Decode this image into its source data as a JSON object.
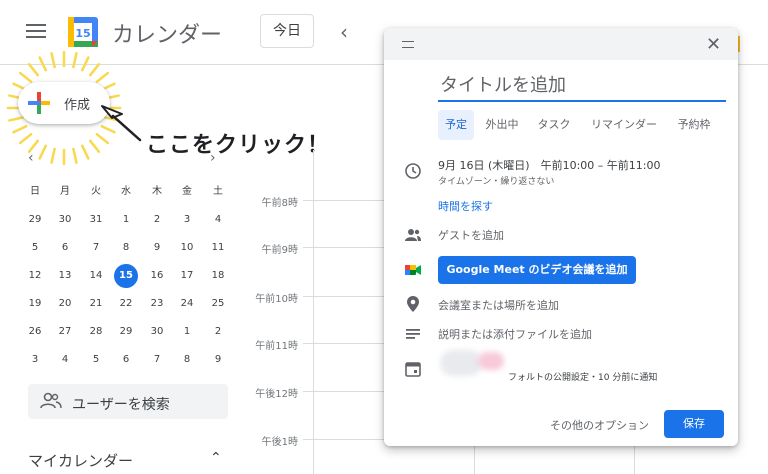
{
  "header": {
    "app_title": "カレンダー",
    "logo_day": "15",
    "today_button": "今日",
    "prev_icon": "chevron-left-icon"
  },
  "create": {
    "label": "作成",
    "callout": "ここをクリック！"
  },
  "mini_calendar": {
    "weekdays": [
      "日",
      "月",
      "火",
      "水",
      "木",
      "金",
      "土"
    ],
    "weeks": [
      [
        "29",
        "30",
        "31",
        "1",
        "2",
        "3",
        "4"
      ],
      [
        "5",
        "6",
        "7",
        "8",
        "9",
        "10",
        "11"
      ],
      [
        "12",
        "13",
        "14",
        "15",
        "16",
        "17",
        "18"
      ],
      [
        "19",
        "20",
        "21",
        "22",
        "23",
        "24",
        "25"
      ],
      [
        "26",
        "27",
        "28",
        "29",
        "30",
        "1",
        "2"
      ],
      [
        "3",
        "4",
        "5",
        "6",
        "7",
        "8",
        "9"
      ]
    ],
    "today": "15"
  },
  "people_search": {
    "label": "ユーザーを検索"
  },
  "my_calendars": {
    "label": "マイカレンダー"
  },
  "time_labels": [
    "午前8時",
    "午前9時",
    "午前10時",
    "午前11時",
    "午後12時",
    "午後1時"
  ],
  "dialog": {
    "title_placeholder": "タイトルを追加",
    "tabs": [
      "予定",
      "外出中",
      "タスク",
      "リマインダー",
      "予約枠"
    ],
    "active_tab": "予定",
    "date_time": "9月 16日 (木曜日)　午前10:00 – 午前11:00",
    "date_sub": "タイムゾーン・繰り返さない",
    "find_time": "時間を探す",
    "add_guests": "ゲストを追加",
    "meet_button": "Google Meet のビデオ会議を追加",
    "add_location": "会議室または場所を追加",
    "add_description": "説明または添付ファイルを追加",
    "calendar_setting": "フォルトの公開設定・10 分前に通知",
    "more_options": "その他のオプション",
    "save": "保存"
  }
}
